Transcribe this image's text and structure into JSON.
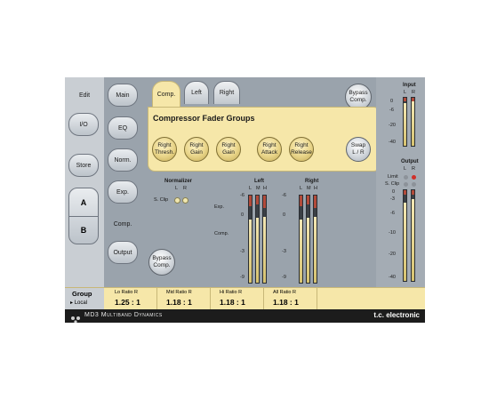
{
  "left_column": {
    "edit": "Edit",
    "io": "I/O",
    "store": "Store",
    "a": "A",
    "b": "B"
  },
  "nav": {
    "main": "Main",
    "eq": "EQ",
    "norm": "Norm.",
    "exp": "Exp.",
    "comp": "Comp.",
    "output": "Output"
  },
  "tabs": {
    "comp": "Comp.",
    "left": "Left",
    "right": "Right"
  },
  "bypass_top": "Bypass Comp.",
  "panel": {
    "title": "Compressor Fader Groups",
    "buttons": [
      {
        "label": "Right Thresh."
      },
      {
        "label": "Right Gain"
      },
      {
        "label": "Right Gain"
      },
      {
        "label": "Right Attack"
      },
      {
        "label": "Right Release"
      }
    ],
    "swap": "Swap L / R"
  },
  "normalizer": {
    "title": "Normalizer",
    "l": "L",
    "r": "R",
    "sclip": "S. Clip"
  },
  "left_meters": {
    "title": "Left",
    "l": "L",
    "m": "M",
    "h": "H",
    "scale": [
      "-6",
      "0",
      "-3",
      "-9"
    ]
  },
  "right_meters": {
    "title": "Right",
    "l": "L",
    "m": "M",
    "h": "H",
    "scale": [
      "-6",
      "0",
      "-3",
      "-9"
    ]
  },
  "exp_label": "Exp.",
  "comp_label": "Comp.",
  "bypass_bottom": "Bypass Comp.",
  "input": {
    "title": "Input",
    "l": "L",
    "r": "R",
    "scale": [
      "0",
      "-6",
      "-20",
      "-40"
    ],
    "levels": [
      0.88,
      0.92
    ]
  },
  "output": {
    "title": "Output",
    "l": "L",
    "r": "R",
    "limit": "Limit",
    "sclip": "S. Clip",
    "scale": [
      "0",
      "-3",
      "-6",
      "-10",
      "-20",
      "-40"
    ],
    "levels": [
      0.86,
      0.9
    ]
  },
  "bottom": {
    "group": "Group",
    "local": "Local",
    "ratios": [
      {
        "label": "Lo Ratio R",
        "value": "1.25 : 1"
      },
      {
        "label": "Mid Ratio R",
        "value": "1.18 : 1"
      },
      {
        "label": "Hi Ratio R",
        "value": "1.18 : 1"
      },
      {
        "label": "All Ratio R",
        "value": "1.18 : 1"
      }
    ]
  },
  "footer": {
    "product": "MD3 Multiband Dynamics",
    "brand": "t.c. electronic"
  },
  "colors": {
    "panel": "#f6e7a9",
    "device_bg": "#9aa3ac",
    "footer_bg": "#1c1c1c",
    "accent_red": "#d0302a"
  },
  "meter_levels": {
    "left_gain": [
      0.72,
      0.74,
      0.76
    ],
    "left_reduction": [
      0.12,
      0.1,
      0.14
    ],
    "right_gain": [
      0.72,
      0.74,
      0.76
    ],
    "right_reduction": [
      0.12,
      0.1,
      0.14
    ]
  }
}
